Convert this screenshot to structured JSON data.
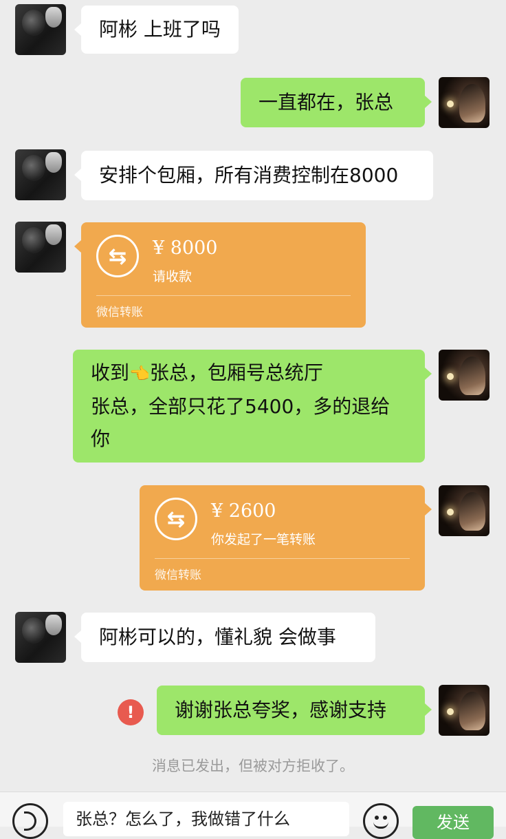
{
  "messages": [
    {
      "side": "left",
      "type": "text",
      "text": "阿彬 上班了吗"
    },
    {
      "side": "right",
      "type": "text",
      "text": "一直都在，张总"
    },
    {
      "side": "left",
      "type": "text",
      "text": "安排个包厢，所有消费控制在8000"
    },
    {
      "side": "left",
      "type": "transfer",
      "amount": "¥ 8000",
      "note": "请收款",
      "footer": "微信转账"
    },
    {
      "side": "right",
      "type": "text",
      "lines": [
        "收到",
        "张总，包厢号总统厅",
        "张总，全部只花了5400，多的退给",
        "你"
      ],
      "emoji": "👈"
    },
    {
      "side": "right",
      "type": "transfer",
      "amount": "¥ 2600",
      "note": "你发起了一笔转账",
      "footer": "微信转账"
    },
    {
      "side": "left",
      "type": "text",
      "text": "阿彬可以的，懂礼貌 会做事"
    },
    {
      "side": "right",
      "type": "text",
      "text": "谢谢张总夸奖，感谢支持",
      "error": "!"
    }
  ],
  "system_message": "消息已发出，但被对方拒收了。",
  "input_bar": {
    "draft": "张总？怎么了，我做错了什么",
    "send_label": "发送"
  },
  "colors": {
    "background": "#ececec",
    "green_bubble": "#9de66a",
    "transfer": "#f1a94e",
    "error": "#e85a4f",
    "send": "#61b861"
  },
  "icons": [
    "voice-icon",
    "transfer-icon",
    "error-icon",
    "emoji-icon"
  ]
}
